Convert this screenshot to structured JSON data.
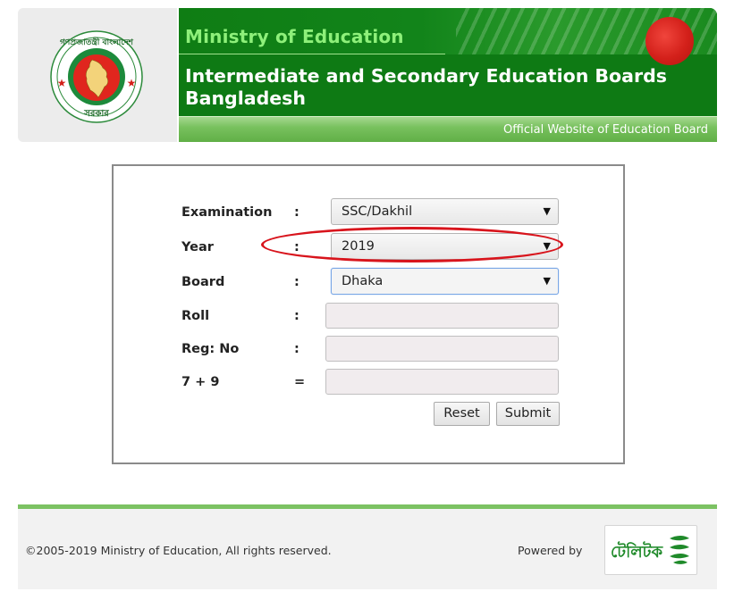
{
  "header": {
    "logo_text_top": "গণপ্রজাতন্ত্রী বাংলাদেশ",
    "logo_text_bottom": "সরকার",
    "ministry": "Ministry of Education",
    "boards_title": "Intermediate and Secondary Education Boards Bangladesh",
    "tagline": "Official Website of Education Board"
  },
  "form": {
    "rows": [
      {
        "label": "Examination",
        "sep": ":",
        "type": "select",
        "value": "SSC/Dakhil"
      },
      {
        "label": "Year",
        "sep": ":",
        "type": "select",
        "value": "2019"
      },
      {
        "label": "Board",
        "sep": ":",
        "type": "select",
        "value": "Dhaka"
      },
      {
        "label": "Roll",
        "sep": ":",
        "type": "text",
        "value": ""
      },
      {
        "label": "Reg: No",
        "sep": ":",
        "type": "text",
        "value": ""
      },
      {
        "label": "7 + 9",
        "sep": "=",
        "type": "text",
        "value": ""
      }
    ],
    "reset_label": "Reset",
    "submit_label": "Submit",
    "annotation_color": "#d8141c"
  },
  "footer": {
    "copyright": "©2005-2019 Ministry of Education, All rights reserved.",
    "powered_by": "Powered by",
    "sponsor_logo_text": "টেলিটক"
  },
  "colors": {
    "header_green": "#0e7a14",
    "ministry_text": "#8ef07a",
    "strip_green": "#78c15e",
    "footer_line": "#7cc263",
    "flag_red": "#d3201a"
  }
}
